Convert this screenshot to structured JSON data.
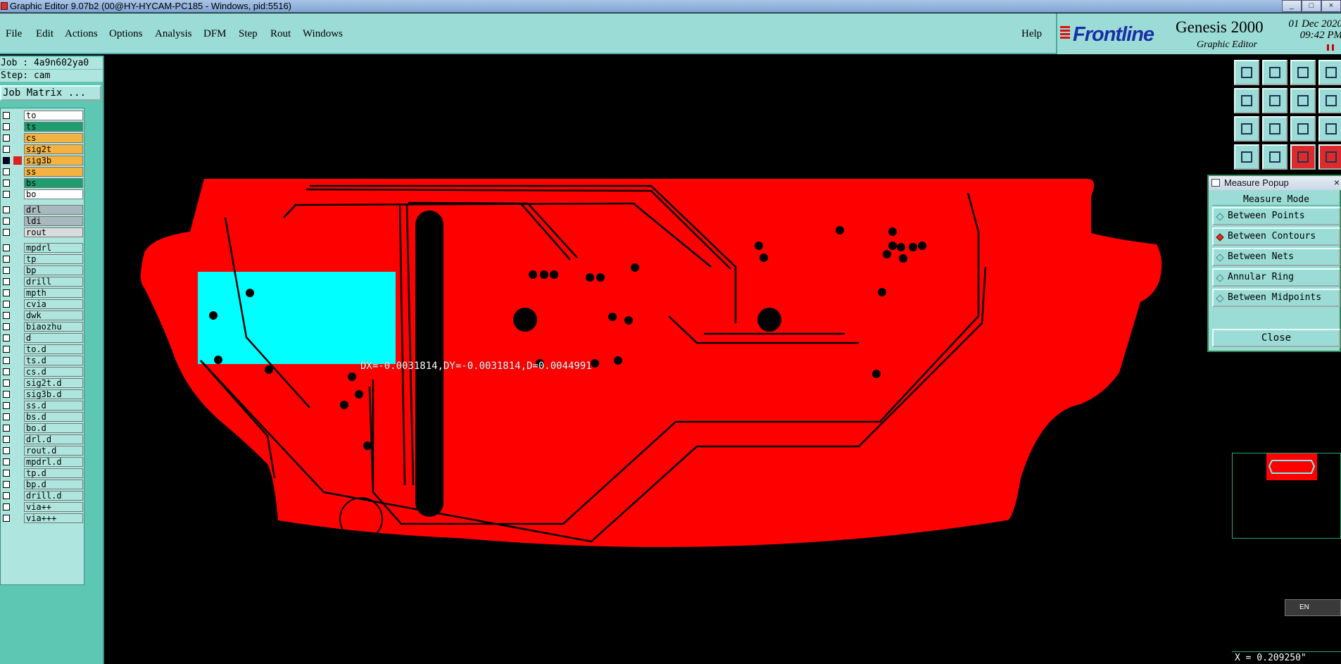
{
  "window": {
    "title": "Graphic Editor 9.07b2 (00@HY-HYCAM-PC185 - Windows, pid:5516)"
  },
  "menu": {
    "items": [
      "File",
      "Edit",
      "Actions",
      "Options",
      "Analysis",
      "DFM",
      "Step",
      "Rout",
      "Windows"
    ],
    "help": "Help"
  },
  "brand": {
    "logo": "Frontline",
    "product": "Genesis 2000",
    "subtitle": "Graphic Editor",
    "date": "01 Dec 2020",
    "time": "09:42 PM"
  },
  "job": {
    "job_line": "Job : 4a9n602ya0",
    "step_line": "Step: cam",
    "matrix_button": "Job Matrix ..."
  },
  "layers": [
    {
      "name": "to",
      "color": "#ffffff",
      "group": 0
    },
    {
      "name": "ts",
      "color": "#1e9e6e",
      "group": 0
    },
    {
      "name": "cs",
      "color": "#f4b340",
      "group": 0
    },
    {
      "name": "sig2t",
      "color": "#f4b340",
      "group": 0
    },
    {
      "name": "sig3b",
      "color": "#f4b340",
      "group": 0,
      "active": true
    },
    {
      "name": "ss",
      "color": "#f4b340",
      "group": 0
    },
    {
      "name": "bs",
      "color": "#1e9e6e",
      "group": 0
    },
    {
      "name": "bo",
      "color": "#ffffff",
      "group": 0
    },
    {
      "name": "drl",
      "color": "#a9b8bf",
      "group": 1
    },
    {
      "name": "ldi",
      "color": "#a9b8bf",
      "group": 1
    },
    {
      "name": "rout",
      "color": "#d9dcdc",
      "group": 1
    },
    {
      "name": "mpdrl",
      "color": "#aee6df",
      "group": 2
    },
    {
      "name": "tp",
      "color": "#aee6df",
      "group": 2
    },
    {
      "name": "bp",
      "color": "#aee6df",
      "group": 2
    },
    {
      "name": "drill",
      "color": "#aee6df",
      "group": 2
    },
    {
      "name": "mpth",
      "color": "#aee6df",
      "group": 2
    },
    {
      "name": "cvia",
      "color": "#aee6df",
      "group": 2
    },
    {
      "name": "dwk",
      "color": "#aee6df",
      "group": 2
    },
    {
      "name": "biaozhu",
      "color": "#aee6df",
      "group": 2
    },
    {
      "name": "d",
      "color": "#aee6df",
      "group": 2
    },
    {
      "name": "to.d",
      "color": "#aee6df",
      "group": 2
    },
    {
      "name": "ts.d",
      "color": "#aee6df",
      "group": 2
    },
    {
      "name": "cs.d",
      "color": "#aee6df",
      "group": 2
    },
    {
      "name": "sig2t.d",
      "color": "#aee6df",
      "group": 2
    },
    {
      "name": "sig3b.d",
      "color": "#aee6df",
      "group": 2
    },
    {
      "name": "ss.d",
      "color": "#aee6df",
      "group": 2
    },
    {
      "name": "bs.d",
      "color": "#aee6df",
      "group": 2
    },
    {
      "name": "bo.d",
      "color": "#aee6df",
      "group": 2
    },
    {
      "name": "drl.d",
      "color": "#aee6df",
      "group": 2
    },
    {
      "name": "rout.d",
      "color": "#aee6df",
      "group": 2
    },
    {
      "name": "mpdrl.d",
      "color": "#aee6df",
      "group": 2
    },
    {
      "name": "tp.d",
      "color": "#aee6df",
      "group": 2
    },
    {
      "name": "bp.d",
      "color": "#aee6df",
      "group": 2
    },
    {
      "name": "drill.d",
      "color": "#aee6df",
      "group": 2
    },
    {
      "name": "via++",
      "color": "#aee6df",
      "group": 2
    },
    {
      "name": "via+++",
      "color": "#aee6df",
      "group": 2
    }
  ],
  "canvas": {
    "board_color": "#ff0000",
    "highlight_color": "#00ffff",
    "measure_readout": "DX=-0.0031814,DY=-0.0031814,D=0.0044991"
  },
  "measure_popup": {
    "title": "Measure Popup",
    "heading": "Measure Mode",
    "options": [
      "Between Points",
      "Between Contours",
      "Between Nets",
      "Annular Ring",
      "Between Midpoints"
    ],
    "selected": "Between Contours",
    "close": "Close"
  },
  "toolbar_icons": [
    "open-job-icon",
    "save-icon",
    "home-icon",
    "window-icon",
    "zoom-in-icon",
    "zoom-out-icon",
    "zoom-back-icon",
    "snap-icon",
    "fit-icon",
    "pan-icon",
    "scale-icon",
    "help-icon",
    "measure-tool-icon",
    "grid-icon",
    "net-red-icon",
    "net-red-icon-2"
  ],
  "status": {
    "coord": "X = 0.209250\"",
    "lang": "EN"
  }
}
